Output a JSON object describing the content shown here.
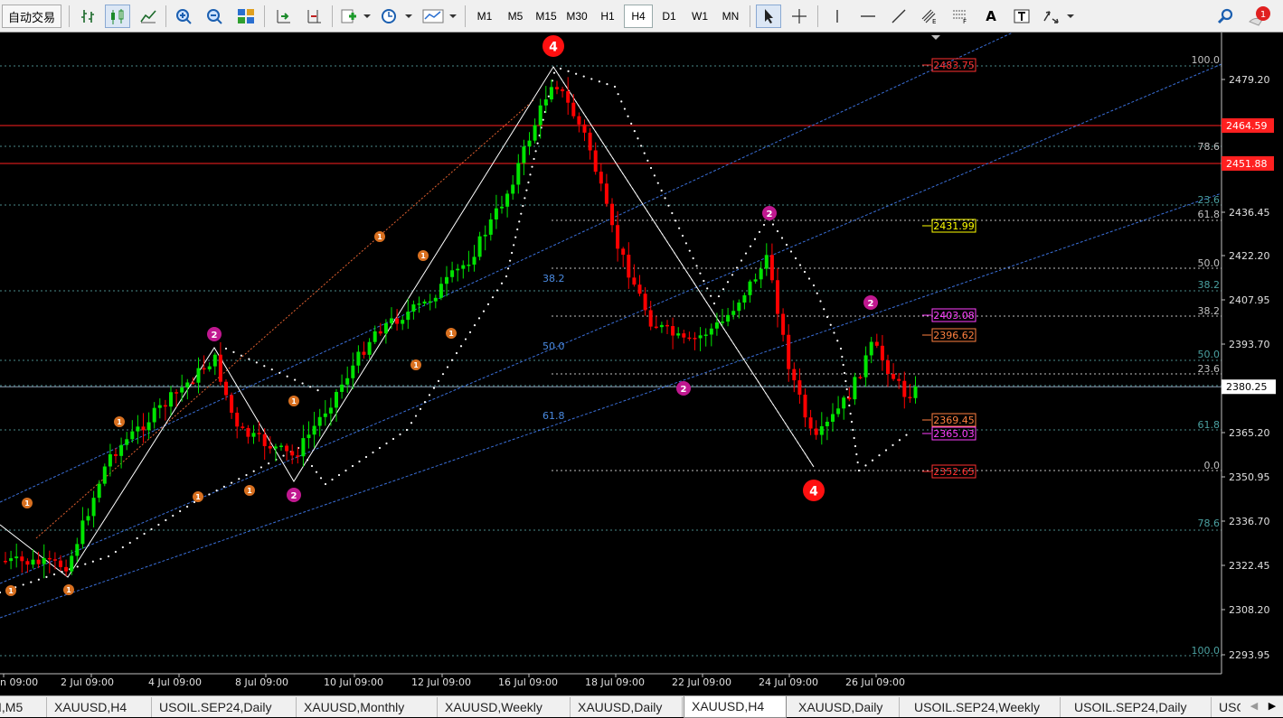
{
  "toolbar": {
    "auto_trade_label": "自动交易",
    "timeframes": [
      "M1",
      "M5",
      "M15",
      "M30",
      "H1",
      "H4",
      "D1",
      "W1",
      "MN"
    ],
    "active_timeframe": "H4",
    "text_tool_label": "A",
    "notification_count": "1"
  },
  "chart": {
    "symbol": "XAUUSD",
    "timeframe": "H4",
    "price_axis": [
      "2479.20",
      "2436.45",
      "2422.20",
      "2407.95",
      "2393.70",
      "2365.20",
      "2350.95",
      "2336.70",
      "2322.45",
      "2308.20",
      "2293.95"
    ],
    "current_price": "2380.25",
    "price_tags_red": [
      "2464.59",
      "2451.88"
    ],
    "time_axis": [
      "n 09:00",
      "2 Jul 09:00",
      "4 Jul 09:00",
      "8 Jul 09:00",
      "10 Jul 09:00",
      "12 Jul 09:00",
      "16 Jul 09:00",
      "18 Jul 09:00",
      "22 Jul 09:00",
      "24 Jul 09:00",
      "26 Jul 09:00"
    ],
    "fib_right_labels": [
      "100.0",
      "78.6",
      "23.6",
      "61.8",
      "50.0",
      "38.2",
      "38.2",
      "50.0",
      "23.6",
      "61.8",
      "0.0",
      "78.6",
      "100.0"
    ],
    "fib_mid_labels": [
      "38.2",
      "50.0",
      "61.8"
    ],
    "level_boxes": [
      {
        "value": "2483.75",
        "color": "#ff3030"
      },
      {
        "value": "2431.99",
        "color": "#ffff00"
      },
      {
        "value": "2403.08",
        "color": "#ff40ff"
      },
      {
        "value": "2396.62",
        "color": "#ff8040"
      },
      {
        "value": "2369.45",
        "color": "#ff8040"
      },
      {
        "value": "2365.03",
        "color": "#ff40ff"
      },
      {
        "value": "2352.65",
        "color": "#ff3030"
      }
    ],
    "wave_labels": [
      "4",
      "4",
      "2",
      "2",
      "2",
      "2",
      "2",
      "1",
      "1",
      "1",
      "1",
      "1",
      "1",
      "1",
      "1",
      "1",
      "1",
      "1"
    ],
    "colors": {
      "bull": "#00e400",
      "bear": "#ff0000",
      "grid": "#4a8a8a",
      "fib_blue": "#3a6fd8",
      "red_line": "#ff2020"
    }
  },
  "tabs": {
    "items": [
      "I,M5",
      "XAUUSD,H4",
      "USOIL.SEP24,Daily",
      "XAUUSD,Monthly",
      "XAUUSD,Weekly",
      "XAUUSD,Daily",
      "XAUUSD,H4",
      "XAUUSD,Daily",
      "USOIL.SEP24,Weekly",
      "USOIL.SEP24,Daily",
      "USO"
    ],
    "active_index": 6
  }
}
